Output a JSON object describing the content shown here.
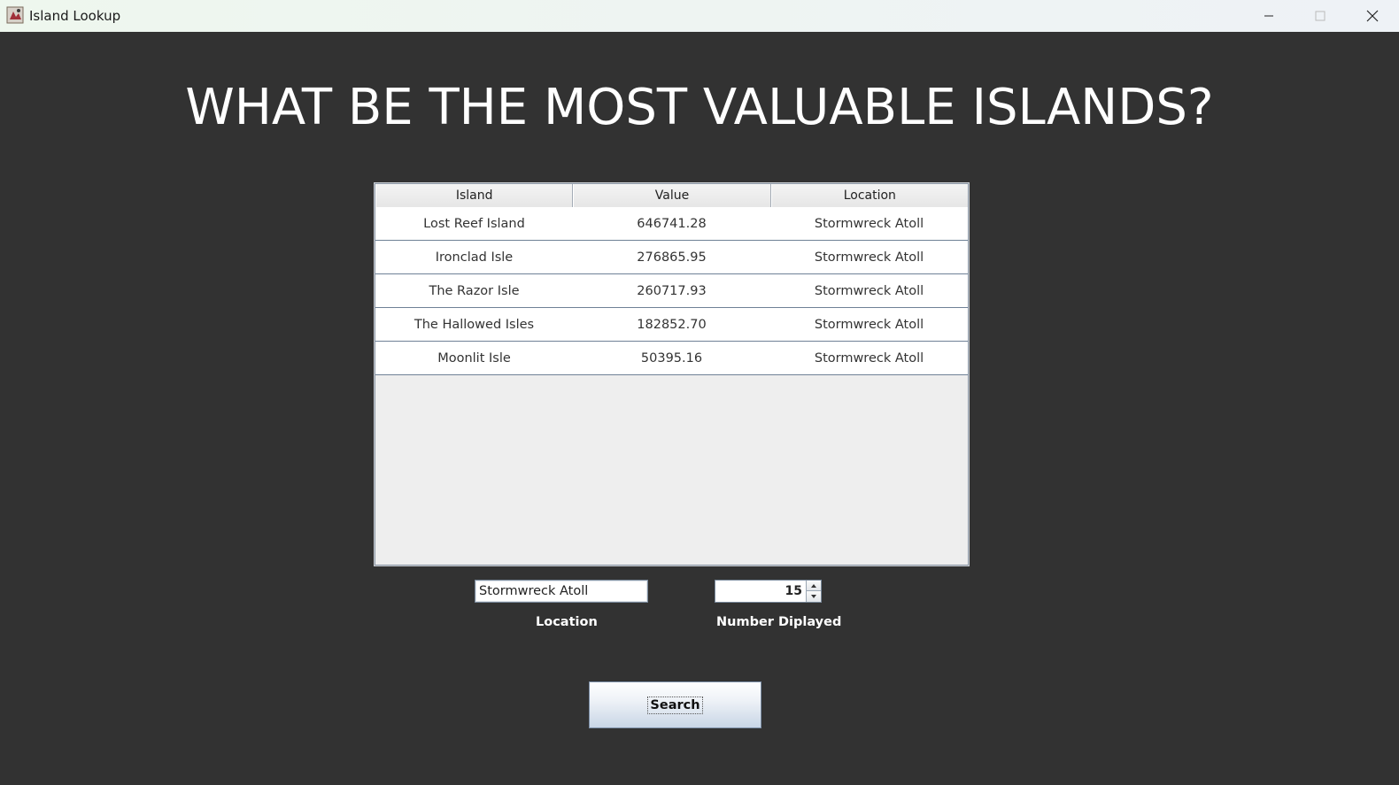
{
  "window": {
    "title": "Island Lookup",
    "app_icon": "java-app-icon",
    "controls": [
      "minimize-icon",
      "maximize-icon",
      "close-icon"
    ]
  },
  "headline": "WHAT BE THE MOST VALUABLE ISLANDS?",
  "table": {
    "columns": [
      "Island",
      "Value",
      "Location"
    ],
    "rows": [
      [
        "Lost Reef Island",
        "646741.28",
        "Stormwreck Atoll"
      ],
      [
        "Ironclad Isle",
        "276865.95",
        "Stormwreck Atoll"
      ],
      [
        "The Razor Isle",
        "260717.93",
        "Stormwreck Atoll"
      ],
      [
        "The Hallowed Isles",
        "182852.70",
        "Stormwreck Atoll"
      ],
      [
        "Moonlit Isle",
        "50395.16",
        "Stormwreck Atoll"
      ]
    ]
  },
  "location_field": {
    "value": "Stormwreck Atoll",
    "label": "Location"
  },
  "number_field": {
    "value": "15",
    "label": "Number Diplayed"
  },
  "search_button": {
    "label": "Search"
  },
  "colors": {
    "background": "#323232",
    "text": "#ffffff"
  }
}
